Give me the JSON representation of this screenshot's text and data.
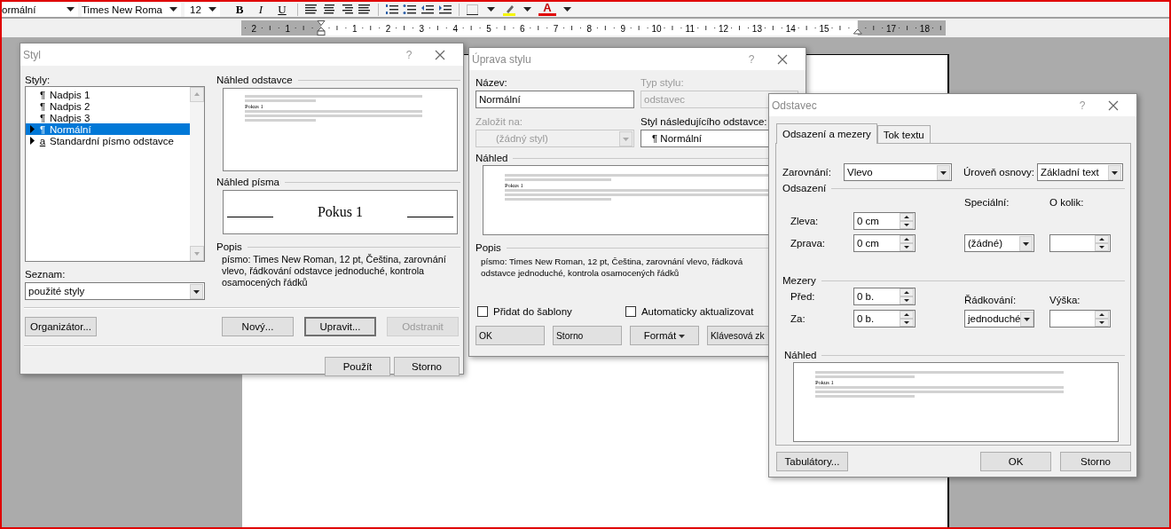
{
  "toolbar": {
    "style_box": "ormální",
    "font_box": "Times New Roma",
    "size_box": "12",
    "format_buttons": [
      "B",
      "I",
      "U"
    ],
    "font_color_button": "A"
  },
  "ruler": {
    "left_margin_labels": [
      "2",
      "1"
    ],
    "labels": [
      "1",
      "2",
      "3",
      "4",
      "5",
      "6",
      "7",
      "8",
      "9",
      "10",
      "11",
      "12",
      "13",
      "14",
      "15"
    ],
    "right_margin_labels": [
      "17",
      "18"
    ]
  },
  "style_dialog": {
    "title": "Styl",
    "help": "?",
    "list_label": "Styly:",
    "styles": [
      {
        "symbol": "¶",
        "name": "Nadpis 1",
        "expandable": false,
        "selected": false
      },
      {
        "symbol": "¶",
        "name": "Nadpis 2",
        "expandable": false,
        "selected": false
      },
      {
        "symbol": "¶",
        "name": "Nadpis 3",
        "expandable": false,
        "selected": false
      },
      {
        "symbol": "¶",
        "name": "Normální",
        "expandable": true,
        "selected": true
      },
      {
        "symbol": "a",
        "name": "Standardní písmo odstavce",
        "expandable": true,
        "selected": false
      }
    ],
    "filter_label": "Seznam:",
    "filter_value": "použité styly",
    "paragraph_preview_label": "Náhled odstavce",
    "paragraph_preview_caption": "Pokus 1",
    "font_preview_label": "Náhled písma",
    "font_preview_text": "Pokus 1",
    "description_label": "Popis",
    "description": "písmo: Times New Roman, 12 pt, Čeština, zarovnání vlevo, řádkování odstavce jednoduché, kontrola osamocených řádků",
    "buttons": [
      {
        "label": "Organizátor...",
        "disabled": false,
        "default": false
      },
      {
        "label": "Nový...",
        "disabled": false,
        "default": false
      },
      {
        "label": "Upravit...",
        "disabled": false,
        "default": true
      },
      {
        "label": "Odstranit",
        "disabled": true,
        "default": false
      }
    ],
    "footer_buttons": [
      {
        "label": "Použít",
        "disabled": false,
        "default": false
      },
      {
        "label": "Storno",
        "disabled": false,
        "default": false
      }
    ]
  },
  "modify_dialog": {
    "title": "Úprava stylu",
    "help": "?",
    "name_label": "Název:",
    "name_value": "Normální",
    "type_label": "Typ stylu:",
    "type_value": "odstavec",
    "based_label": "Založit na:",
    "based_value": "(žádný styl)",
    "next_label": "Styl následujícího odstavce:",
    "next_value": "¶ Normální",
    "preview_label": "Náhled",
    "preview_caption": "Pokus 1",
    "description_label": "Popis",
    "description_lines": [
      "písmo: Times New Roman, 12 pt, Čeština, zarovnání vlevo, řádková",
      "odstavce jednoduché, kontrola osamocených řádků"
    ],
    "checkboxes": [
      {
        "label": "Přidat do šablony",
        "checked": false
      },
      {
        "label": "Automaticky aktualizovat",
        "checked": false
      }
    ],
    "buttons": [
      {
        "label": "OK",
        "kind": "plain"
      },
      {
        "label": "Storno",
        "kind": "plain"
      },
      {
        "label": "Formát",
        "kind": "menu"
      },
      {
        "label": "Klávesová zk",
        "kind": "plain"
      }
    ]
  },
  "paragraph_dialog": {
    "title": "Odstavec",
    "help": "?",
    "tabs": [
      {
        "label": "Odsazení a mezery",
        "selected": true
      },
      {
        "label": "Tok textu",
        "selected": false
      }
    ],
    "alignment_label": "Zarovnání:",
    "alignment_value": "Vlevo",
    "outline_label": "Úroveň osnovy:",
    "outline_value": "Základní text",
    "indent_section": "Odsazení",
    "left_label": "Zleva:",
    "left_value": "0 cm",
    "right_label": "Zprava:",
    "right_value": "0 cm",
    "special_label": "Speciální:",
    "special_value": "(žádné)",
    "by_label": "O kolik:",
    "spacing_section": "Mezery",
    "before_label": "Před:",
    "before_value": "0 b.",
    "after_label": "Za:",
    "after_value": "0 b.",
    "line_label": "Řádkování:",
    "line_value": "jednoduché",
    "height_label": "Výška:",
    "preview_label": "Náhled",
    "preview_caption": "Pokus 1",
    "buttons": [
      {
        "label": "Tabulátory..."
      },
      {
        "label": "OK"
      },
      {
        "label": "Storno"
      }
    ]
  }
}
